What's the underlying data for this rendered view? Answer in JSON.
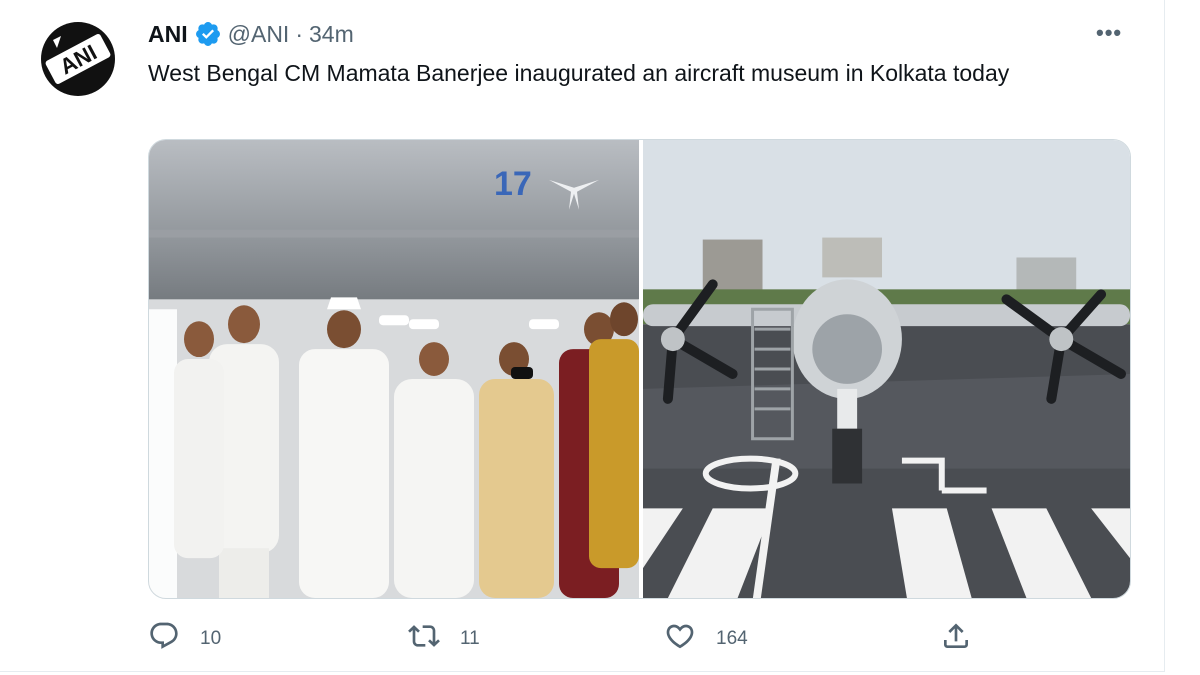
{
  "tweet": {
    "author_name": "ANI",
    "handle": "@ANI",
    "separator": "·",
    "time": "34m",
    "avatar_text": "ANI",
    "text": "West Bengal CM Mamata Banerjee inaugurated an aircraft museum in Kolkata today",
    "aircraft_tail_number": "17",
    "runway_marking_left": "0",
    "runway_marking_right": "1"
  },
  "actions": {
    "replies": "10",
    "retweets": "11",
    "likes": "164"
  },
  "colors": {
    "verified": "#1d9bf0",
    "text_secondary": "#536471",
    "border": "#cfd9de"
  },
  "icons": [
    "verified-badge-icon",
    "more-icon",
    "reply-icon",
    "retweet-icon",
    "like-icon",
    "share-icon"
  ]
}
